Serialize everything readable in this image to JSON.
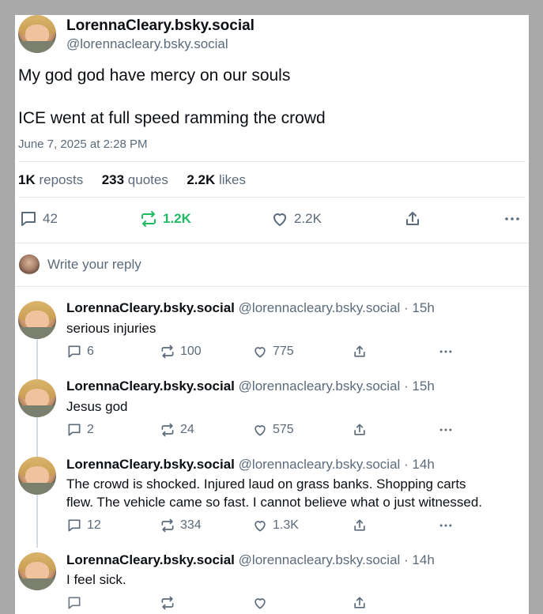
{
  "main_post": {
    "display_name": "LorennaCleary.bsky.social",
    "handle": "@lorennacleary.bsky.social",
    "text_line1": "My god god have mercy on our souls",
    "text_line2": "ICE went at full speed ramming the crowd",
    "timestamp": "June 7, 2025 at 2:28 PM",
    "stats": {
      "reposts_count": "1K",
      "reposts_label": "reposts",
      "quotes_count": "233",
      "quotes_label": "quotes",
      "likes_count": "2.2K",
      "likes_label": "likes"
    },
    "actions": {
      "replies": "42",
      "reposts": "1.2K",
      "likes": "2.2K"
    }
  },
  "reply_box": {
    "placeholder": "Write your reply"
  },
  "replies": [
    {
      "display_name": "LorennaCleary.bsky.social",
      "handle": "@lorennacleary.bsky.social",
      "time": "· 15h",
      "text": "serious injuries",
      "replies": "6",
      "reposts": "100",
      "likes": "775"
    },
    {
      "display_name": "LorennaCleary.bsky.social",
      "handle": "@lorennacleary.bsky.social",
      "time": "· 15h",
      "text": "Jesus god",
      "replies": "2",
      "reposts": "24",
      "likes": "575"
    },
    {
      "display_name": "LorennaCleary.bsky.social",
      "handle": "@lorennacleary.bsky.social",
      "time": "· 14h",
      "text_line1": "The crowd is shocked. Injured laud on grass banks. Shopping carts",
      "text_line2": "flew. The vehicle came so fast. I cannot believe what o just witnessed.",
      "replies": "12",
      "reposts": "334",
      "likes": "1.3K"
    },
    {
      "display_name": "LorennaCleary.bsky.social",
      "handle": "@lorennacleary.bsky.social",
      "time": "· 14h",
      "text": "I feel sick."
    }
  ],
  "colors": {
    "repost_active": "#20bc64",
    "muted": "#5b6b7b",
    "divider": "#e3e8ee",
    "frame": "#a9a9a9"
  },
  "icons": [
    "reply-icon",
    "repost-icon",
    "like-icon",
    "share-icon",
    "more-icon"
  ]
}
